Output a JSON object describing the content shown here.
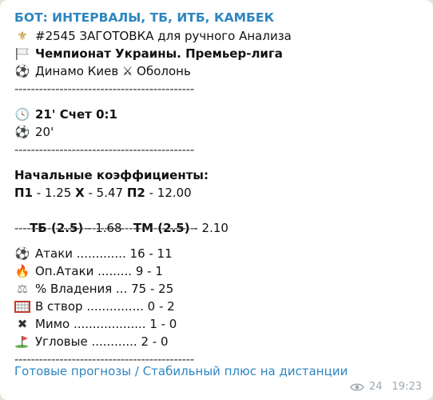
{
  "message": {
    "sender": "БОТ: ИНТЕРВАЛЫ, ТБ, ИТБ, КАМБЕК",
    "header_line": "#2545 ЗАГОТОВКА для ручного Анализа",
    "league": "Чемпионат Украины. Премьер-лига",
    "teams": "Динамо Киев ⚔ Оболонь",
    "separator": "--------------------------------------------",
    "minute_score": "21' Счет 0:1",
    "minute2": "20'",
    "odds_title": "Начальные коэффициенты:",
    "p1_label": "П1",
    "p1_value": " - 1.25 ",
    "x_label": "Х",
    "x_value": " - 5.47 ",
    "p2_label": "П2",
    "p2_value": " - 12.00",
    "tb_label": "ТБ (2.5)",
    "tb_value": " - 1.68   ",
    "tm_label": "ТМ (2.5)",
    "tm_value": " - 2.10",
    "stats": {
      "attacks": "Атаки ............. 16 - 11",
      "danger_attacks": "Оп.Атаки ......... 9 - 1",
      "possession": "% Владения ... 75 - 25",
      "on_target": "В створ ............... 0 - 2",
      "off_target": "Мимо ................... 1 - 0",
      "corners": "Угловые ............ 2 - 0"
    },
    "link_text": "Готовые прогнозы / Стабильный плюс на дистанции",
    "views": "24",
    "time": "19:23"
  },
  "icons": {
    "fleur": "⚜",
    "ball": "⚽",
    "clock": "🕓",
    "fire": "🔥",
    "scales": "⚖",
    "cross": "✖"
  }
}
